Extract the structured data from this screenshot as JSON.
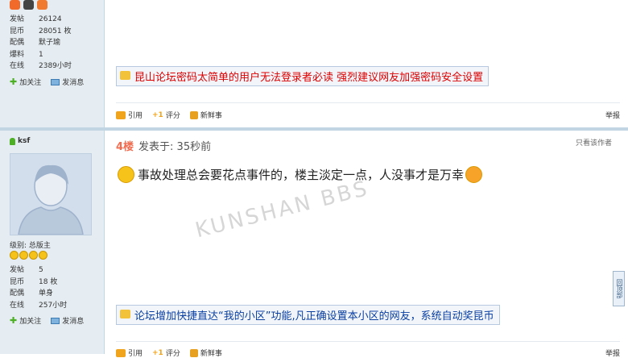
{
  "user1": {
    "stats": [
      {
        "k": "发帖",
        "v": "26124"
      },
      {
        "k": "昆币",
        "v": "28051 枚"
      },
      {
        "k": "配偶",
        "v": "默子瑜"
      },
      {
        "k": "爆料",
        "v": "1"
      },
      {
        "k": "在线",
        "v": "2389小时"
      }
    ],
    "follow_label": "加关注",
    "message_label": "发消息"
  },
  "post1": {
    "notice": "昆山论坛密码太简单的用户无法登录者必读 强烈建议网友加强密码安全设置",
    "quote_label": "引用",
    "rate_label": "评分",
    "new_label": "新鲜事",
    "report_label": "举报"
  },
  "user2": {
    "name": "ksf",
    "rank": "级别: 总版主",
    "stats": [
      {
        "k": "发帖",
        "v": "5"
      },
      {
        "k": "昆币",
        "v": "18 枚"
      },
      {
        "k": "配偶",
        "v": "单身"
      },
      {
        "k": "在线",
        "v": "257小时"
      }
    ],
    "follow_label": "加关注",
    "message_label": "发消息"
  },
  "post2": {
    "floor": "4楼",
    "posted": "发表于: 35秒前",
    "only_author": "只看该作者",
    "content": "事故处理总会要花点事件的，楼主淡定一点，人没事才是万幸",
    "notice": "论坛增加快捷直达“我的小区”功能,凡正确设置本小区的网友，系统自动奖昆币",
    "quote_label": "引用",
    "rate_label": "评分",
    "new_label": "新鲜事",
    "report_label": "举报"
  },
  "watermark": "KUNSHAN BBS",
  "side_tab": "回顶部",
  "colors": {
    "sidebar_bg": "#e5edf2",
    "floor": "#f26c4f",
    "notice_red": "#dd0000",
    "notice_blue": "#0a3fa0"
  }
}
